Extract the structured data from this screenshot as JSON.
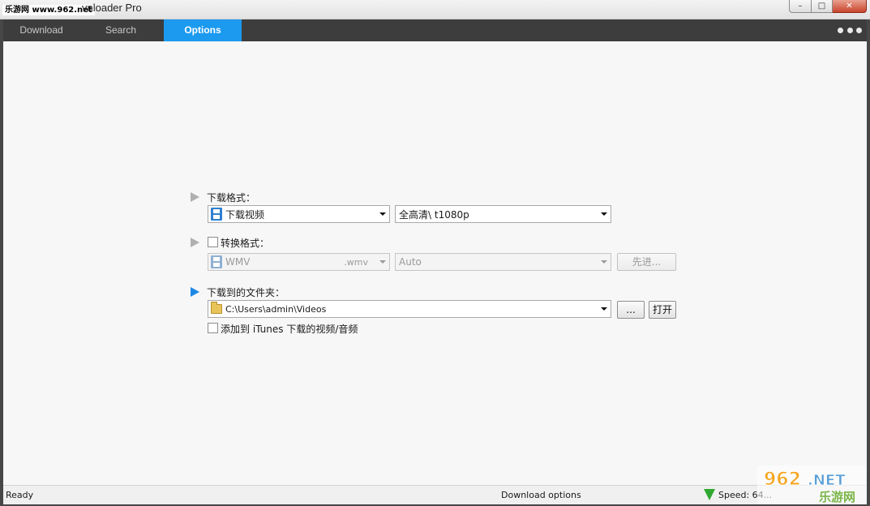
{
  "window": {
    "watermark_tag": "乐游网 www.962.net",
    "title": "vnloader Pro",
    "minimize": "–",
    "maximize": "□",
    "close": "✕"
  },
  "tabs": [
    {
      "label": "Download",
      "active": false
    },
    {
      "label": "Search",
      "active": false
    },
    {
      "label": "Options",
      "active": true
    }
  ],
  "options": {
    "download_format": {
      "label": "下载格式：",
      "type_value": "下载视频",
      "quality_value": "全高清\\ t1080p"
    },
    "convert_format": {
      "label": "转换格式：",
      "checked": false,
      "format_value": "WMV",
      "format_ext": ".wmv",
      "preset_value": "Auto",
      "advanced_button": "先进..."
    },
    "download_folder": {
      "label": "下载到的文件夹：",
      "path_value": "C:\\Users\\admin\\Videos",
      "browse_button": "...",
      "open_button": "打开"
    },
    "itunes": {
      "label": "添加到 iTunes 下载的视频/音频",
      "checked": false
    }
  },
  "statusbar": {
    "status": "Ready",
    "center": "Download options",
    "speed": "Speed: 64..."
  },
  "brand_watermark": {
    "text_top": "962.NET",
    "text_bottom": "乐游网"
  },
  "colors": {
    "tab_active": "#1b9aef",
    "tab_bar": "#3d3d3d",
    "arrow_active": "#1e88e5",
    "arrow_inactive": "#b0b0b0",
    "speed_icon": "#2fa82f"
  }
}
